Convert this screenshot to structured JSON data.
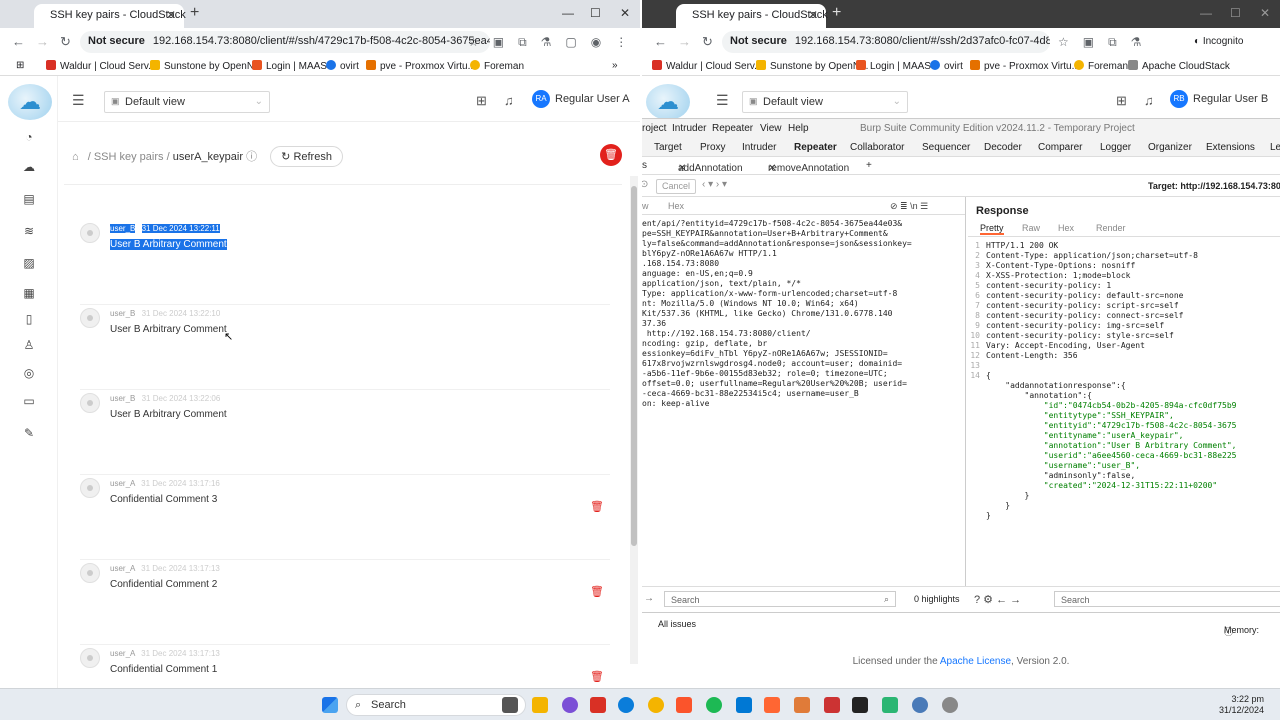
{
  "left_window": {
    "tab_title": "SSH key pairs - CloudStack",
    "url_security": "Not secure",
    "url": "192.168.154.73:8080/client/#/ssh/4729c17b-f508-4c2c-8054-3675ea44e...",
    "bookmarks": [
      "Waldur | Cloud Serv...",
      "Sunstone by OpenN...",
      "Login | MAAS",
      "ovirt",
      "pve - Proxmox Virtu...",
      "Foreman"
    ],
    "default_view": "Default view",
    "user_initials": "RA",
    "user_name": "Regular User A",
    "breadcrumb": [
      "SSH key pairs",
      "userA_keypair"
    ],
    "refresh_label": "Refresh",
    "comments": [
      {
        "user": "user_B",
        "time": "31 Dec 2024 13:22:11",
        "text": "User B Arbitrary Comment",
        "selected": true,
        "deletable": false
      },
      {
        "user": "user_B",
        "time": "31 Dec 2024 13:22:10",
        "text": "User B Arbitrary Comment",
        "selected": false,
        "deletable": false
      },
      {
        "user": "user_B",
        "time": "31 Dec 2024 13:22:06",
        "text": "User B Arbitrary Comment",
        "selected": false,
        "deletable": false
      },
      {
        "user": "user_A",
        "time": "31 Dec 2024 13:17:16",
        "text": "Confidential Comment 3",
        "selected": false,
        "deletable": true
      },
      {
        "user": "user_A",
        "time": "31 Dec 2024 13:17:13",
        "text": "Confidential Comment 2",
        "selected": false,
        "deletable": true
      },
      {
        "user": "user_A",
        "time": "31 Dec 2024 13:17:13",
        "text": "Confidential Comment 1",
        "selected": false,
        "deletable": true
      }
    ]
  },
  "right_window": {
    "tab_title": "SSH key pairs - CloudStack",
    "url_security": "Not secure",
    "url": "192.168.154.73:8080/client/#/ssh/2d37afc0-fc07-4d81-a101-...",
    "incognito": "Incognito",
    "bookmarks": [
      "Waldur | Cloud Serv...",
      "Sunstone by OpenN...",
      "Login | MAAS",
      "ovirt",
      "pve - Proxmox Virtu...",
      "Foreman",
      "Apache CloudStack"
    ],
    "default_view": "Default view",
    "user_initials": "RB",
    "user_name": "Regular User B",
    "burp": {
      "menu": [
        "roject",
        "Intruder",
        "Repeater",
        "View",
        "Help"
      ],
      "title": "Burp Suite Community Edition v2024.11.2 - Temporary Project",
      "tabs": [
        "Target",
        "Proxy",
        "Intruder",
        "Repeater",
        "Collaborator",
        "Sequencer",
        "Decoder",
        "Comparer",
        "Logger",
        "Organizer",
        "Extensions",
        "Le"
      ],
      "repeater_tabs": [
        "s",
        "addAnnotation",
        "removeAnnotation",
        "+"
      ],
      "cancel": "Cancel",
      "target": "Target: http://192.168.154.73:80",
      "request_tabs": [
        "w",
        "Hex"
      ],
      "request_lines": [
        "ent/api/?entityid=4729c17b-f508-4c2c-8054-3675ea44e03&",
        "pe=SSH_KEYPAIR&annotation=User+B+Arbitrary+Comment&",
        "ly=false&command=addAnnotation&response=json&sessionkey=",
        "blY6pyZ-nORe1A6A67w HTTP/1.1",
        ".168.154.73:8080",
        "anguage: en-US,en;q=0.9",
        "application/json, text/plain, */*",
        "Type: application/x-www-form-urlencoded;charset=utf-8",
        "nt: Mozilla/5.0 (Windows NT 10.0; Win64; x64)",
        "Kit/537.36 (KHTML, like Gecko) Chrome/131.0.6778.140",
        "37.36",
        " http://192.168.154.73:8080/client/",
        "ncoding: gzip, deflate, br",
        "essionkey=6diFv_hTbl Y6pyZ-nORe1A6A67w; JSESSIONID=",
        "617x8rvojwzrnlswgdrosg4.node0; account=user; domainid=",
        "-a5b6-11ef-9b6e-00155d83eb32; role=0; timezone=UTC;",
        "offset=0.0; userfullname=Regular%20User%20%20B; userid=",
        "-ceca-4669-bc31-88e22534i5c4; username=user_B",
        "on: keep-alive"
      ],
      "response_title": "Response",
      "response_tabs": [
        "Pretty",
        "Raw",
        "Hex",
        "Render"
      ],
      "response_lines": [
        "HTTP/1.1 200 OK",
        "Content-Type: application/json;charset=utf-8",
        "X-Content-Type-Options: nosniff",
        "X-XSS-Protection: 1;mode=block",
        "content-security-policy: 1",
        "content-security-policy: default-src=none",
        "content-security-policy: script-src=self",
        "content-security-policy: connect-src=self",
        "content-security-policy: img-src=self",
        "content-security-policy: style-src=self",
        "Vary: Accept-Encoding, User-Agent",
        "Content-Length: 356",
        "",
        "{",
        "    \"addannotationresponse\":{",
        "        \"annotation\":{",
        "            \"id\":\"0474cb54-0b2b-4205-894a-cfc0df75b9",
        "            \"entitytype\":\"SSH_KEYPAIR\",",
        "            \"entityid\":\"4729c17b-f508-4c2c-8054-3675",
        "            \"entityname\":\"userA_keypair\",",
        "            \"annotation\":\"User B Arbitrary Comment\",",
        "            \"userid\":\"a6ee4560-ceca-4669-bc31-88e225",
        "            \"username\":\"user_B\",",
        "            \"adminsonly\":false,",
        "            \"created\":\"2024-12-31T15:22:11+0200\"",
        "        }",
        "    }",
        "}"
      ],
      "search_placeholder": "Search",
      "highlights": "0 highlights",
      "all_issues": "All issues",
      "memory": "Memory:"
    },
    "footer": {
      "prefix": "Licensed under the ",
      "link": "Apache License",
      "suffix": ", Version 2.0."
    }
  },
  "taskbar": {
    "search": "Search",
    "time": "3:22 pm",
    "date": "31/12/2024"
  }
}
